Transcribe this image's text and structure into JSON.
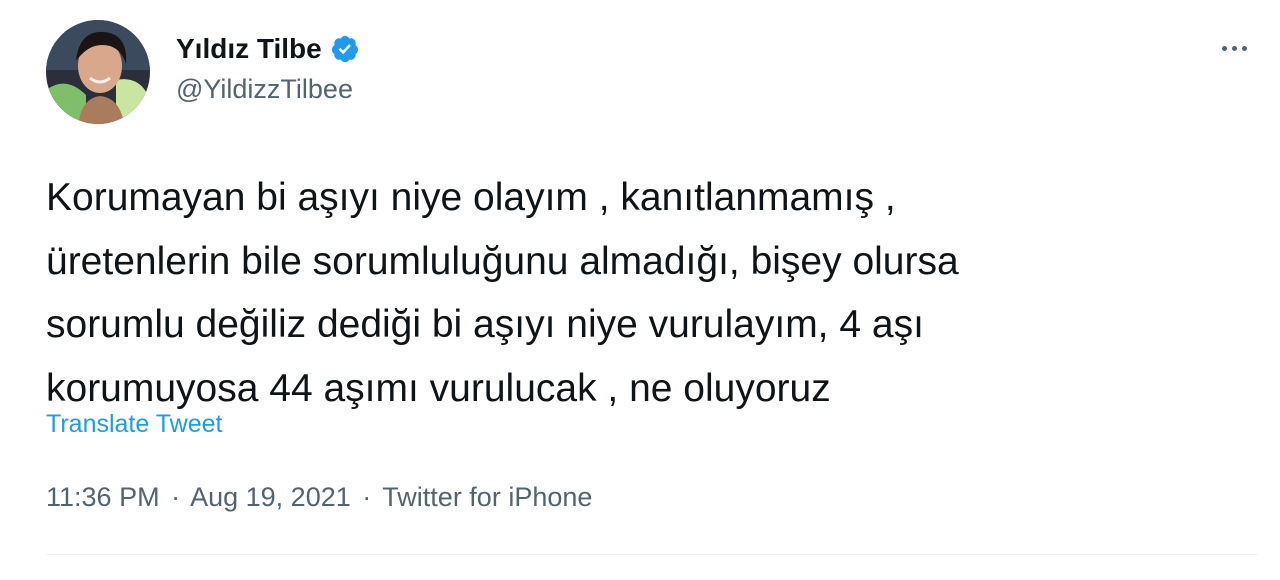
{
  "author": {
    "display_name": "Yıldız Tilbe",
    "handle": "@YildizzTilbee",
    "verified": true,
    "avatar_icon": "profile-photo"
  },
  "menu": {
    "icon": "more-horizontal-icon"
  },
  "tweet": {
    "lines": [
      "Korumayan bi aşıyı niye olayım , kanıtlanmamış ,",
      "üretenlerin bile sorumluluğunu almadığı, bişey olursa",
      "sorumlu değiliz dediği bi aşıyı niye vurulayım, 4 aşı",
      "korumuyosa 44 aşımı vurulucak , ne oluyoruz"
    ],
    "translate_label": "Translate Tweet"
  },
  "meta": {
    "time": "11:36 PM",
    "separator": "·",
    "date": "Aug 19, 2021",
    "source": "Twitter for iPhone"
  },
  "colors": {
    "accent": "#1d9bf0",
    "secondary_text": "#536471",
    "primary_text": "#0f1419"
  }
}
